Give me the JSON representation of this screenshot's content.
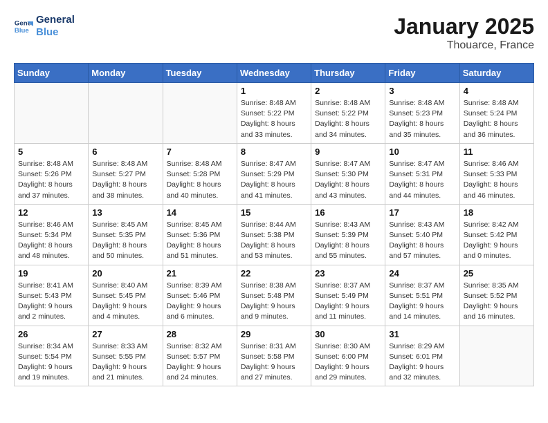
{
  "header": {
    "logo_line1": "General",
    "logo_line2": "Blue",
    "month": "January 2025",
    "location": "Thouarce, France"
  },
  "weekdays": [
    "Sunday",
    "Monday",
    "Tuesday",
    "Wednesday",
    "Thursday",
    "Friday",
    "Saturday"
  ],
  "weeks": [
    [
      {
        "day": "",
        "info": ""
      },
      {
        "day": "",
        "info": ""
      },
      {
        "day": "",
        "info": ""
      },
      {
        "day": "1",
        "info": "Sunrise: 8:48 AM\nSunset: 5:22 PM\nDaylight: 8 hours\nand 33 minutes."
      },
      {
        "day": "2",
        "info": "Sunrise: 8:48 AM\nSunset: 5:22 PM\nDaylight: 8 hours\nand 34 minutes."
      },
      {
        "day": "3",
        "info": "Sunrise: 8:48 AM\nSunset: 5:23 PM\nDaylight: 8 hours\nand 35 minutes."
      },
      {
        "day": "4",
        "info": "Sunrise: 8:48 AM\nSunset: 5:24 PM\nDaylight: 8 hours\nand 36 minutes."
      }
    ],
    [
      {
        "day": "5",
        "info": "Sunrise: 8:48 AM\nSunset: 5:26 PM\nDaylight: 8 hours\nand 37 minutes."
      },
      {
        "day": "6",
        "info": "Sunrise: 8:48 AM\nSunset: 5:27 PM\nDaylight: 8 hours\nand 38 minutes."
      },
      {
        "day": "7",
        "info": "Sunrise: 8:48 AM\nSunset: 5:28 PM\nDaylight: 8 hours\nand 40 minutes."
      },
      {
        "day": "8",
        "info": "Sunrise: 8:47 AM\nSunset: 5:29 PM\nDaylight: 8 hours\nand 41 minutes."
      },
      {
        "day": "9",
        "info": "Sunrise: 8:47 AM\nSunset: 5:30 PM\nDaylight: 8 hours\nand 43 minutes."
      },
      {
        "day": "10",
        "info": "Sunrise: 8:47 AM\nSunset: 5:31 PM\nDaylight: 8 hours\nand 44 minutes."
      },
      {
        "day": "11",
        "info": "Sunrise: 8:46 AM\nSunset: 5:33 PM\nDaylight: 8 hours\nand 46 minutes."
      }
    ],
    [
      {
        "day": "12",
        "info": "Sunrise: 8:46 AM\nSunset: 5:34 PM\nDaylight: 8 hours\nand 48 minutes."
      },
      {
        "day": "13",
        "info": "Sunrise: 8:45 AM\nSunset: 5:35 PM\nDaylight: 8 hours\nand 50 minutes."
      },
      {
        "day": "14",
        "info": "Sunrise: 8:45 AM\nSunset: 5:36 PM\nDaylight: 8 hours\nand 51 minutes."
      },
      {
        "day": "15",
        "info": "Sunrise: 8:44 AM\nSunset: 5:38 PM\nDaylight: 8 hours\nand 53 minutes."
      },
      {
        "day": "16",
        "info": "Sunrise: 8:43 AM\nSunset: 5:39 PM\nDaylight: 8 hours\nand 55 minutes."
      },
      {
        "day": "17",
        "info": "Sunrise: 8:43 AM\nSunset: 5:40 PM\nDaylight: 8 hours\nand 57 minutes."
      },
      {
        "day": "18",
        "info": "Sunrise: 8:42 AM\nSunset: 5:42 PM\nDaylight: 9 hours\nand 0 minutes."
      }
    ],
    [
      {
        "day": "19",
        "info": "Sunrise: 8:41 AM\nSunset: 5:43 PM\nDaylight: 9 hours\nand 2 minutes."
      },
      {
        "day": "20",
        "info": "Sunrise: 8:40 AM\nSunset: 5:45 PM\nDaylight: 9 hours\nand 4 minutes."
      },
      {
        "day": "21",
        "info": "Sunrise: 8:39 AM\nSunset: 5:46 PM\nDaylight: 9 hours\nand 6 minutes."
      },
      {
        "day": "22",
        "info": "Sunrise: 8:38 AM\nSunset: 5:48 PM\nDaylight: 9 hours\nand 9 minutes."
      },
      {
        "day": "23",
        "info": "Sunrise: 8:37 AM\nSunset: 5:49 PM\nDaylight: 9 hours\nand 11 minutes."
      },
      {
        "day": "24",
        "info": "Sunrise: 8:37 AM\nSunset: 5:51 PM\nDaylight: 9 hours\nand 14 minutes."
      },
      {
        "day": "25",
        "info": "Sunrise: 8:35 AM\nSunset: 5:52 PM\nDaylight: 9 hours\nand 16 minutes."
      }
    ],
    [
      {
        "day": "26",
        "info": "Sunrise: 8:34 AM\nSunset: 5:54 PM\nDaylight: 9 hours\nand 19 minutes."
      },
      {
        "day": "27",
        "info": "Sunrise: 8:33 AM\nSunset: 5:55 PM\nDaylight: 9 hours\nand 21 minutes."
      },
      {
        "day": "28",
        "info": "Sunrise: 8:32 AM\nSunset: 5:57 PM\nDaylight: 9 hours\nand 24 minutes."
      },
      {
        "day": "29",
        "info": "Sunrise: 8:31 AM\nSunset: 5:58 PM\nDaylight: 9 hours\nand 27 minutes."
      },
      {
        "day": "30",
        "info": "Sunrise: 8:30 AM\nSunset: 6:00 PM\nDaylight: 9 hours\nand 29 minutes."
      },
      {
        "day": "31",
        "info": "Sunrise: 8:29 AM\nSunset: 6:01 PM\nDaylight: 9 hours\nand 32 minutes."
      },
      {
        "day": "",
        "info": ""
      }
    ]
  ]
}
